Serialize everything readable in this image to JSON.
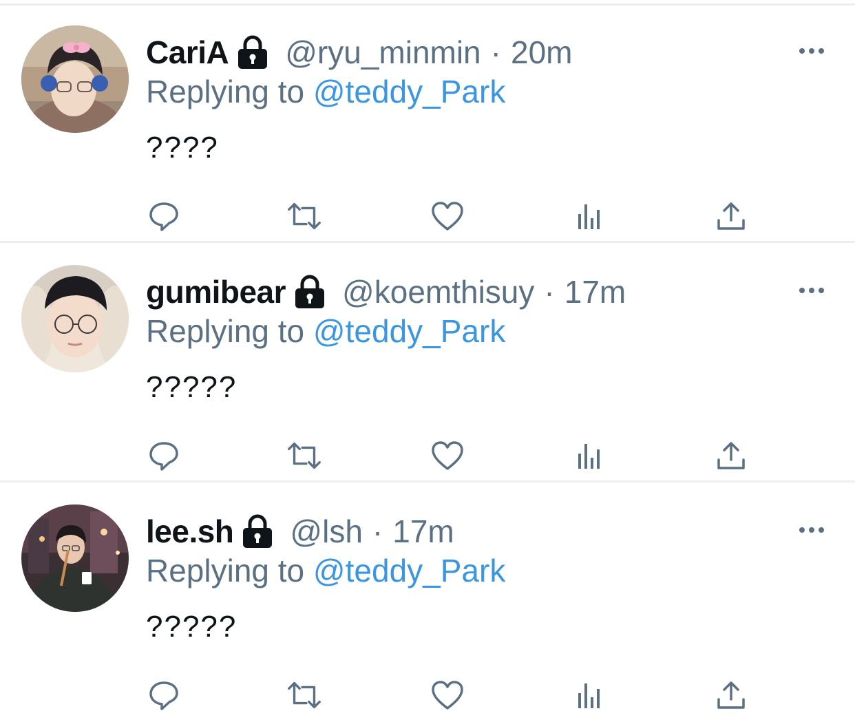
{
  "colors": {
    "text": "#0f1419",
    "secondary": "#5b7083",
    "link": "#3a96e0",
    "divider": "#eceef0"
  },
  "tweets": [
    {
      "display_name": "CariA",
      "handle": "@ryu_minmin",
      "separator": "·",
      "time": "20m",
      "replying_prefix": "Replying to",
      "replying_to": "@teddy_Park",
      "text": "????",
      "protected": true,
      "avatar_icon": "avatar-photo"
    },
    {
      "display_name": "gumibear",
      "handle": "@koemthisuy",
      "separator": "·",
      "time": "17m",
      "replying_prefix": "Replying to",
      "replying_to": "@teddy_Park",
      "text": "?????",
      "protected": true,
      "avatar_icon": "avatar-photo"
    },
    {
      "display_name": "lee.sh",
      "handle": "@lsh",
      "separator": "·",
      "time": "17m",
      "replying_prefix": "Replying to",
      "replying_to": "@teddy_Park",
      "text": "?????",
      "protected": true,
      "avatar_icon": "avatar-photo"
    }
  ],
  "action_icons": [
    "reply-icon",
    "retweet-icon",
    "like-icon",
    "analytics-icon",
    "share-icon"
  ]
}
